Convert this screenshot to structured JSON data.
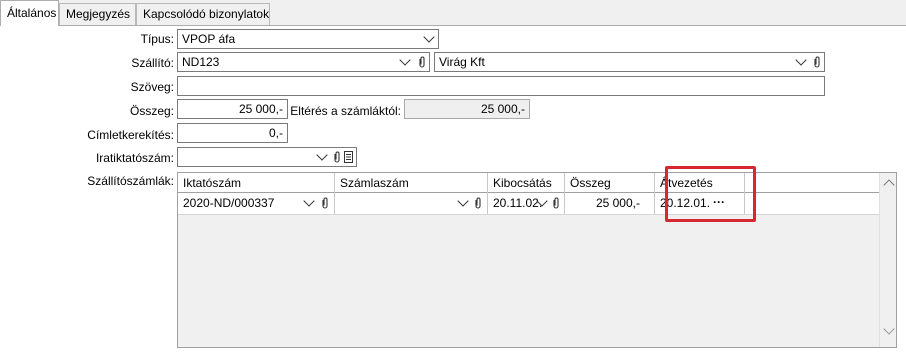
{
  "tabs": [
    {
      "label": "Általános",
      "active": true
    },
    {
      "label": "Megjegyzés",
      "active": false
    },
    {
      "label": "Kapcsolódó bizonylatok",
      "active": false
    }
  ],
  "form": {
    "tipus": {
      "label": "Típus:",
      "value": "VPOP áfa"
    },
    "szallito": {
      "label": "Szállító:",
      "code": "ND123",
      "name": "Virág Kft"
    },
    "szoveg": {
      "label": "Szöveg:",
      "value": ""
    },
    "osszeg": {
      "label": "Összeg:",
      "value": "25 000,-"
    },
    "elteres": {
      "label": "Eltérés a számláktól:",
      "value": "25 000,-"
    },
    "cimletkerekites": {
      "label": "Címletkerekítés:",
      "value": "0,-"
    },
    "iratiktatoszam": {
      "label": "Iratiktatószám:",
      "value": ""
    },
    "szallitoszamlak": {
      "label": "Szállítószámlák:"
    }
  },
  "grid": {
    "columns": [
      "Iktatószám",
      "Számlaszám",
      "Kibocsátás",
      "Összeg",
      "Átvezetés"
    ],
    "rows": [
      {
        "iktatoszam": "2020-ND/000337",
        "szamlaszam": "",
        "kibocsatas": "20.11.02.",
        "osszeg": "25 000,-",
        "atvezetes": "20.12.01.",
        "ellipsis": "···"
      }
    ]
  },
  "colors": {
    "highlight": "#d8282f"
  }
}
